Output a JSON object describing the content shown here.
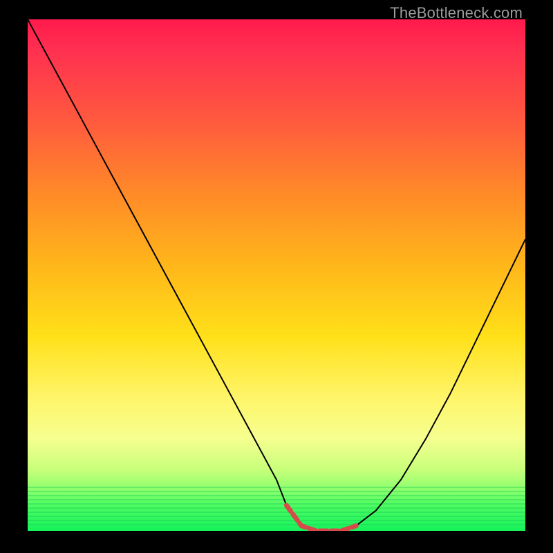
{
  "watermark": "TheBottleneck.com",
  "colors": {
    "gradient_top": "#ff1a4d",
    "gradient_bottom": "#15f25b",
    "curve": "#000000",
    "highlight": "#d84a4a",
    "frame": "#000000"
  },
  "chart_data": {
    "type": "line",
    "title": "",
    "xlabel": "",
    "ylabel": "",
    "xlim": [
      0,
      100
    ],
    "ylim": [
      0,
      100
    ],
    "grid": false,
    "series": [
      {
        "name": "curve",
        "x": [
          0,
          5,
          10,
          15,
          20,
          25,
          30,
          35,
          40,
          45,
          50,
          52,
          55,
          58,
          60,
          63,
          66,
          70,
          75,
          80,
          85,
          90,
          95,
          100
        ],
        "values": [
          100,
          91,
          82,
          73,
          64,
          55,
          46,
          37,
          28,
          19,
          10,
          5,
          1,
          0,
          0,
          0,
          1,
          4,
          10,
          18,
          27,
          37,
          47,
          57
        ]
      },
      {
        "name": "highlight-segment",
        "x": [
          52,
          55,
          58,
          60,
          63,
          66
        ],
        "values": [
          5,
          1,
          0,
          0,
          0,
          1
        ]
      }
    ]
  }
}
